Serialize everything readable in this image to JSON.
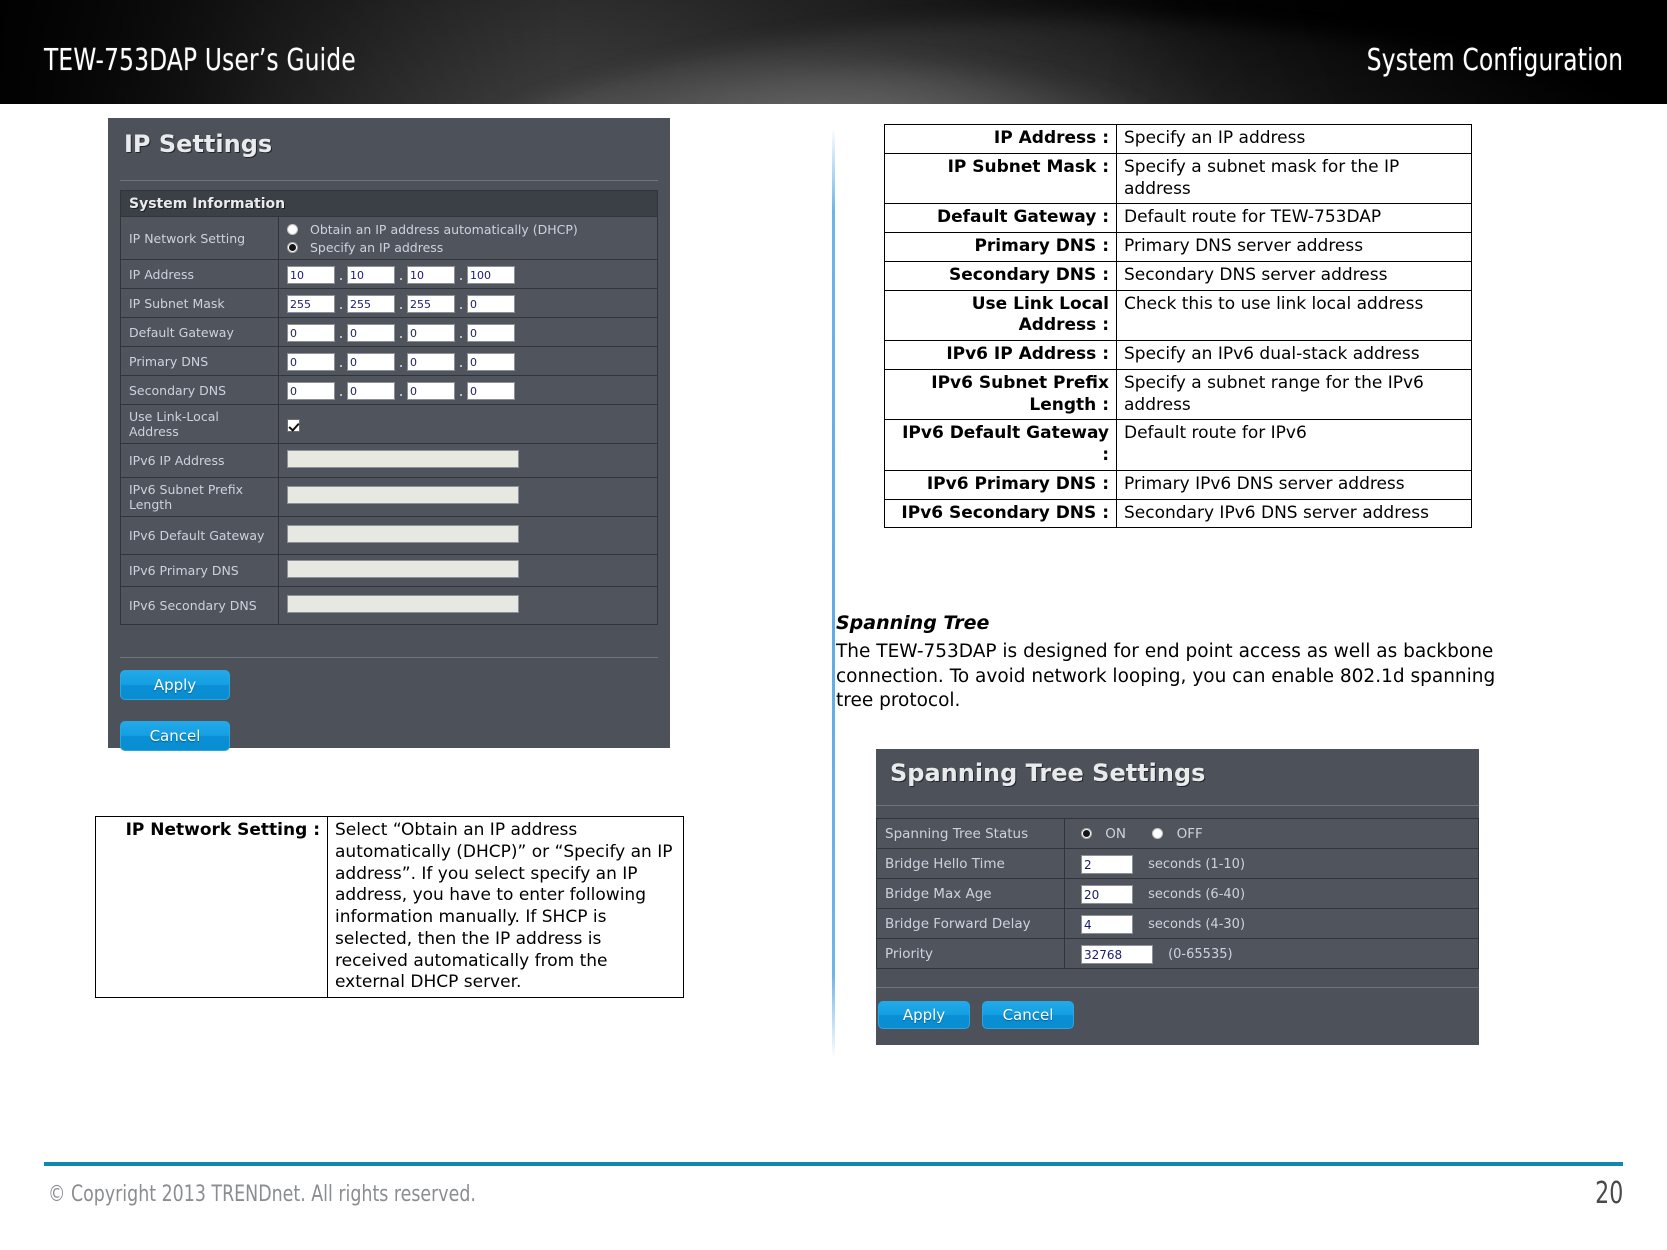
{
  "header": {
    "guide_title": "TEW-753DAP User’s Guide",
    "section_title": "System Configuration"
  },
  "ip_settings_panel": {
    "panel_title": "IP Settings",
    "section_header": "System Information",
    "rows": {
      "ip_network_setting_label": "IP Network Setting",
      "radio_dhcp_label": "Obtain an IP address automatically (DHCP)",
      "radio_static_label": "Specify an IP address",
      "ip_address_label": "IP Address",
      "ip_address_octets": [
        "10",
        "10",
        "10",
        "100"
      ],
      "ip_subnet_mask_label": "IP Subnet Mask",
      "ip_subnet_mask_octets": [
        "255",
        "255",
        "255",
        "0"
      ],
      "default_gateway_label": "Default Gateway",
      "default_gateway_octets": [
        "0",
        "0",
        "0",
        "0"
      ],
      "primary_dns_label": "Primary DNS",
      "primary_dns_octets": [
        "0",
        "0",
        "0",
        "0"
      ],
      "secondary_dns_label": "Secondary DNS",
      "secondary_dns_octets": [
        "0",
        "0",
        "0",
        "0"
      ],
      "use_link_local_label": "Use Link-Local Address",
      "ipv6_ip_address_label": "IPv6 IP Address",
      "ipv6_ip_address_value": "",
      "ipv6_subnet_prefix_label": "IPv6 Subnet Prefix Length",
      "ipv6_subnet_prefix_value": "",
      "ipv6_default_gateway_label": "IPv6 Default Gateway",
      "ipv6_default_gateway_value": "",
      "ipv6_primary_dns_label": "IPv6 Primary DNS",
      "ipv6_primary_dns_value": "",
      "ipv6_secondary_dns_label": "IPv6 Secondary DNS",
      "ipv6_secondary_dns_value": ""
    },
    "apply_label": "Apply",
    "cancel_label": "Cancel"
  },
  "ip_network_setting_table": {
    "key": "IP Network Setting :",
    "value": "Select “Obtain an IP address automatically (DHCP)” or “Specify an IP address”. If you select specify an IP address, you have to enter following information manually. If SHCP is selected, then the IP address is received automatically from the external DHCP server."
  },
  "ip_fields_table": {
    "rows": [
      {
        "key": "IP Address :",
        "value": "Specify an IP address"
      },
      {
        "key": "IP Subnet Mask :",
        "value": "Specify a subnet mask for the IP address"
      },
      {
        "key": "Default Gateway :",
        "value": "Default route for TEW-753DAP"
      },
      {
        "key": "Primary DNS :",
        "value": "Primary DNS server address"
      },
      {
        "key": "Secondary DNS :",
        "value": "Secondary DNS server address"
      },
      {
        "key": "Use Link Local Address :",
        "value": "Check this to use link local address"
      },
      {
        "key": "IPv6 IP Address :",
        "value": "Specify an IPv6 dual-stack address"
      },
      {
        "key": "IPv6 Subnet Prefix Length :",
        "value": "Specify a subnet range for the IPv6 address"
      },
      {
        "key": "IPv6 Default Gateway :",
        "value": "Default route for IPv6"
      },
      {
        "key": "IPv6 Primary DNS :",
        "value": "Primary IPv6 DNS server address"
      },
      {
        "key": "IPv6 Secondary DNS :",
        "value": "Secondary IPv6 DNS server address"
      }
    ]
  },
  "spanning_tree_section": {
    "heading": "Spanning Tree",
    "paragraph": "The TEW-753DAP is designed for end point access as well as backbone connection. To avoid network looping, you can enable 802.1d spanning tree protocol."
  },
  "spanning_tree_panel": {
    "panel_title": "Spanning Tree Settings",
    "status_label": "Spanning Tree Status",
    "status_on_label": "ON",
    "status_off_label": "OFF",
    "hello_time_label": "Bridge Hello Time",
    "hello_time_value": "2",
    "hello_time_unit": "seconds (1-10)",
    "max_age_label": "Bridge Max Age",
    "max_age_value": "20",
    "max_age_unit": "seconds (6-40)",
    "forward_delay_label": "Bridge Forward Delay",
    "forward_delay_value": "4",
    "forward_delay_unit": "seconds (4-30)",
    "priority_label": "Priority",
    "priority_value": "32768",
    "priority_unit": "(0-65535)",
    "apply_label": "Apply",
    "cancel_label": "Cancel"
  },
  "footer": {
    "copyright": "© Copyright 2013 TRENDnet. All rights reserved.",
    "page_number": "20"
  },
  "colors": {
    "panel_bg": "#4c515a",
    "panel_header_bg": "#3b3f46",
    "button_blue": "#13a0e2",
    "footer_rule": "#1287b0",
    "divider_blue": "#56a7e4"
  }
}
